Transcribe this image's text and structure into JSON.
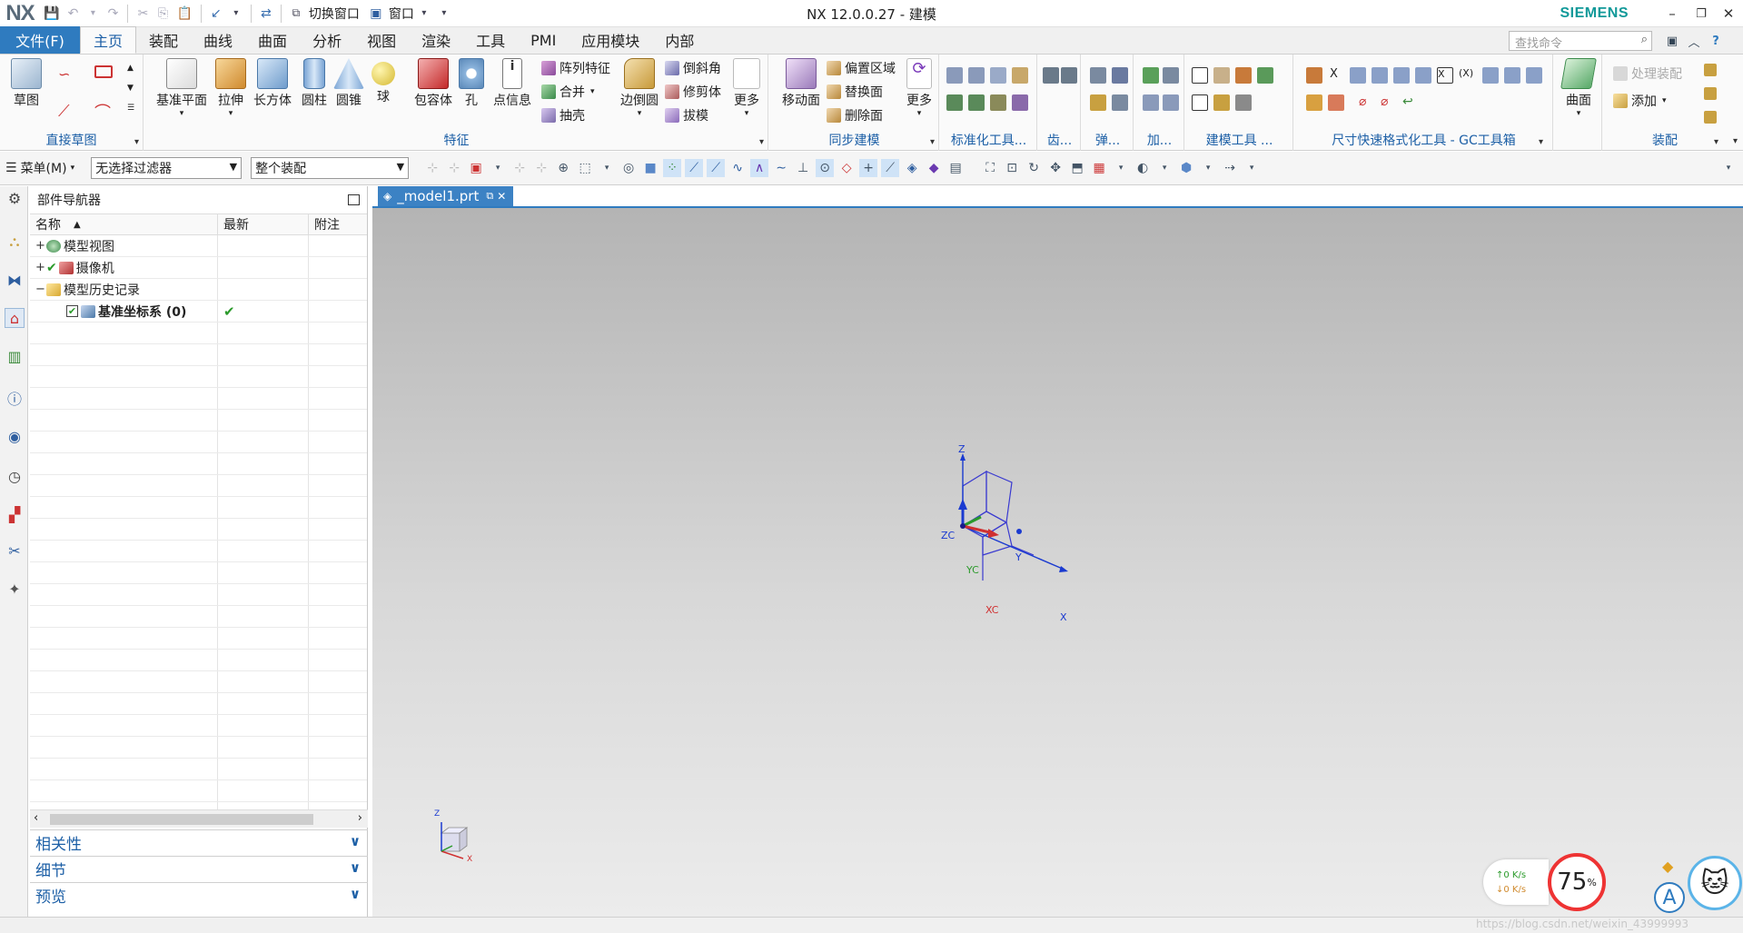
{
  "app": {
    "logo": "NX",
    "title": "NX 12.0.0.27 - 建模",
    "brand": "SIEMENS",
    "quick_access": {
      "switch_window": "切换窗口",
      "window": "窗口"
    }
  },
  "menu_tabs": [
    {
      "label": "文件(F)"
    },
    {
      "label": "主页"
    },
    {
      "label": "装配"
    },
    {
      "label": "曲线"
    },
    {
      "label": "曲面"
    },
    {
      "label": "分析"
    },
    {
      "label": "视图"
    },
    {
      "label": "渲染"
    },
    {
      "label": "工具"
    },
    {
      "label": "PMI"
    },
    {
      "label": "应用模块"
    },
    {
      "label": "内部"
    }
  ],
  "search": {
    "placeholder": "查找命令"
  },
  "ribbon": {
    "direct_sketch": {
      "label": "直接草图",
      "sketch": "草图"
    },
    "feature": {
      "label": "特征",
      "datum_plane": "基准平面",
      "extrude": "拉伸",
      "block": "长方体",
      "cylinder": "圆柱",
      "cone": "圆锥",
      "sphere": "球",
      "bounding_body": "包容体",
      "hole": "孔",
      "point_info": "点信息",
      "pattern_feature": "阵列特征",
      "unite": "合并",
      "shell": "抽壳",
      "edge_blend": "边倒圆",
      "chamfer": "倒斜角",
      "trim_body": "修剪体",
      "draft": "拔模",
      "more": "更多"
    },
    "sync_modeling": {
      "label": "同步建模",
      "move_face": "移动面",
      "offset_region": "偏置区域",
      "replace_face": "替换面",
      "delete_face": "删除面",
      "more": "更多"
    },
    "std_tools": {
      "label": "标准化工具..."
    },
    "gear": {
      "label": "齿..."
    },
    "spring": {
      "label": "弹..."
    },
    "machining": {
      "label": "加..."
    },
    "modeling_tools": {
      "label": "建模工具 ..."
    },
    "dim_tools": {
      "label": "尺寸快速格式化工具 - GC工具箱"
    },
    "surface": {
      "label": "曲面"
    },
    "assembly": {
      "label": "装配",
      "process_assembly": "处理装配",
      "add": "添加"
    }
  },
  "selection_bar": {
    "menu": "菜单(M)",
    "filter": "无选择过滤器",
    "scope": "整个装配"
  },
  "navigator": {
    "title": "部件导航器",
    "columns": [
      "名称",
      "最新",
      "附注"
    ],
    "rows": [
      {
        "label": "模型视图",
        "expand": "+",
        "latest": ""
      },
      {
        "label": "摄像机",
        "expand": "+",
        "latest": ""
      },
      {
        "label": "模型历史记录",
        "expand": "−",
        "latest": ""
      },
      {
        "label": "基准坐标系 (0)",
        "expand": "",
        "latest": "✔"
      }
    ],
    "panels": [
      "相关性",
      "细节",
      "预览"
    ]
  },
  "document": {
    "tab": "_model1.prt"
  },
  "csys": {
    "z": "Z",
    "zc": "ZC",
    "y": "Y",
    "yc": "YC",
    "x": "X",
    "xc": "XC",
    "mini_z": "Z",
    "mini_x": "X"
  },
  "overlay": {
    "up_speed": "↑0 K/s",
    "down_speed": "↓0 K/s",
    "cpu": "75",
    "cpu_unit": "%",
    "a_button": "A",
    "watermark": "https://blog.csdn.net/weixin_43999993"
  },
  "colors": {
    "accent": "#2f7bbf",
    "brand": "#119999",
    "group_label": "#1c5fa6"
  }
}
